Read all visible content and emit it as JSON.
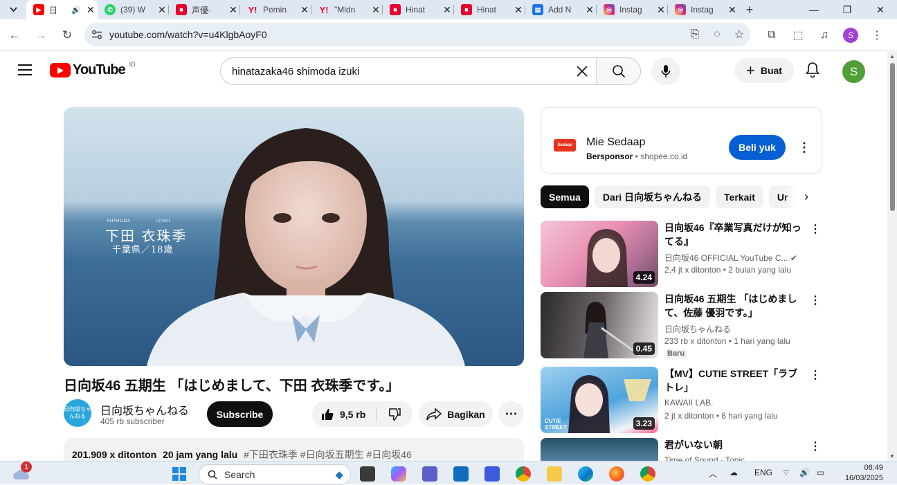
{
  "browser": {
    "tabs": [
      {
        "title": "日",
        "favicon": "youtube-icon",
        "color": "#ff0000",
        "active": true
      },
      {
        "title": "(39) W",
        "favicon": "whatsapp-icon",
        "color": "#25d366"
      },
      {
        "title": "声優·",
        "favicon": "news-icon",
        "color": "#e6002d"
      },
      {
        "title": "Pemin",
        "favicon": "yahoo-icon",
        "color": "#ff0033"
      },
      {
        "title": "\"Midn",
        "favicon": "yahoo-icon",
        "color": "#ff0033"
      },
      {
        "title": "Hinat",
        "favicon": "news-icon",
        "color": "#e6002d"
      },
      {
        "title": "Hinat",
        "favicon": "news-icon",
        "color": "#e6002d"
      },
      {
        "title": "Add N",
        "favicon": "web-icon",
        "color": "#1a73e8"
      },
      {
        "title": "Instag",
        "favicon": "instagram-icon",
        "color": "#d62976"
      },
      {
        "title": "Instag",
        "favicon": "instagram-icon",
        "color": "#d62976"
      }
    ],
    "url": "youtube.com/watch?v=u4KlgbAoyF0",
    "profile_initial": "S"
  },
  "yt": {
    "logo_text": "YouTube",
    "country_code": "ID",
    "search_query": "hinatazaka46 shimoda izuki",
    "create_label": "Buat",
    "avatar_initial": "S",
    "video": {
      "overlay_romaji_last": "SHIMODA",
      "overlay_romaji_first": "IZUKI",
      "overlay_name": "下田 衣珠季",
      "overlay_info": "千葉県／18歳",
      "title": "日向坂46 五期生 「はじめまして、下田 衣珠季です。」",
      "channel": "日向坂ちゃんねる",
      "channel_avatar_text": "日向坂ちゃんねる",
      "subscribers": "405 rb subscriber",
      "subscribe_label": "Subscribe",
      "likes": "9,5 rb",
      "share_label": "Bagikan",
      "views": "201.909 x ditonton",
      "uploaded": "20 jam yang lalu",
      "hashtags": "#下田衣珠季 #日向坂五期生 #日向坂46"
    },
    "ad": {
      "logo_text": "Sedaap",
      "title": "Mie Sedaap",
      "sponsor_label": "Bersponsor",
      "domain": "shopee.co.id",
      "cta": "Beli yuk"
    },
    "chips": [
      "Semua",
      "Dari 日向坂ちゃんねる",
      "Terkait",
      "Ur"
    ],
    "recommendations": [
      {
        "title": "日向坂46『卒業写真だけが知ってる』",
        "channel": "日向坂46 OFFICIAL YouTube C...",
        "meta": "2,4 jt x ditonton • 2 bulan yang lalu",
        "duration": "4.24",
        "verified": true
      },
      {
        "title": "日向坂46 五期生 「はじめまして、佐藤 優羽です。」",
        "channel": "日向坂ちゃんねる",
        "meta": "233 rb x ditonton • 1 hari yang lalu",
        "duration": "0.45",
        "badge": "Baru"
      },
      {
        "title": "【MV】CUTIE STREET「ラブトレ」",
        "channel": "KAWAII LAB.",
        "meta": "2 jt x ditonton • 8 hari yang lalu",
        "duration": "3.23",
        "thumb_text": "CUTIE STREET"
      },
      {
        "title": "君がいない朝",
        "channel": "Time of Sound - Topic",
        "meta": "",
        "duration": ""
      }
    ]
  },
  "taskbar": {
    "search_placeholder": "Search",
    "notification_count": "1",
    "language": "ENG",
    "time": "06:49",
    "date": "16/03/2025"
  },
  "colors": {
    "accent": "#065fd4",
    "brand": "#ff0000",
    "avatar": "#4f9e36"
  }
}
